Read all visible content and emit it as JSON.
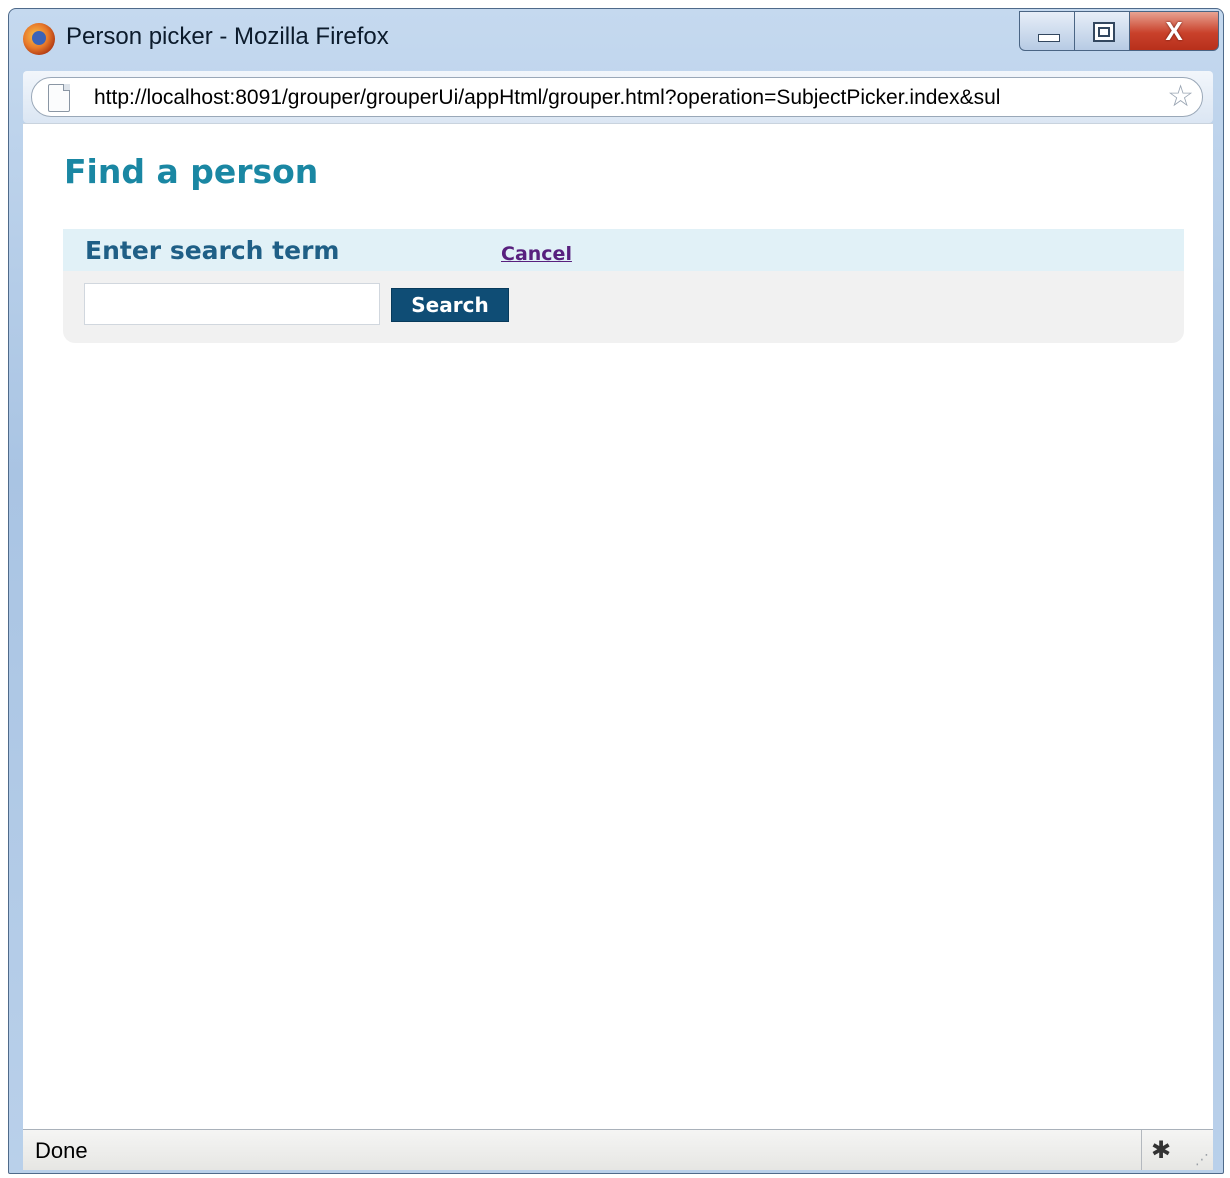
{
  "window": {
    "title": "Person picker - Mozilla Firefox",
    "controls": {
      "minimize": "minimize",
      "maximize": "maximize",
      "close": "X"
    }
  },
  "addressbar": {
    "url": "http://localhost:8091/grouper/grouperUi/appHtml/grouper.html?operation=SubjectPicker.index&sul"
  },
  "page": {
    "title": "Find a person",
    "search_panel": {
      "title": "Enter search term",
      "cancel_label": "Cancel",
      "input_value": "",
      "search_label": "Search"
    }
  },
  "statusbar": {
    "text": "Done"
  },
  "colors": {
    "page_title": "#1a87a3",
    "panel_header_bg": "#e1f1f7",
    "panel_title": "#1f5f86",
    "search_button_bg": "#0f4d75",
    "cancel_link": "#58207e"
  },
  "icons": [
    "firefox-icon",
    "page-icon",
    "bookmark-star-icon",
    "bug-icon",
    "resize-grip-icon"
  ]
}
